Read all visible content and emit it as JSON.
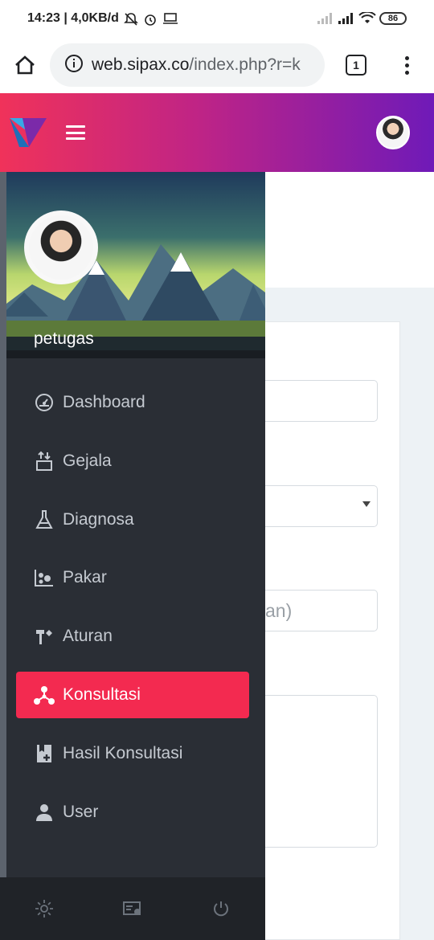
{
  "status_bar": {
    "time_speed": "14:23 | 4,0KB/d",
    "battery": "86",
    "icons": [
      "mute-bell-icon",
      "alarm-icon",
      "laptop-icon",
      "signal-icon",
      "signal-icon",
      "wifi-icon",
      "battery-icon"
    ]
  },
  "browser": {
    "url_domain": "web.sipax.co",
    "url_path": "/index.php?r=k",
    "tab_count": "1",
    "icons": [
      "home-icon",
      "info-icon",
      "more-vert-icon"
    ]
  },
  "header": {
    "icons": [
      "logo-icon",
      "menu-icon",
      "avatar"
    ]
  },
  "sidebar": {
    "profile_name": "petugas",
    "items": [
      {
        "label": "Dashboard",
        "icon": "dashboard-icon",
        "active": false
      },
      {
        "label": "Gejala",
        "icon": "sort-icon",
        "active": false
      },
      {
        "label": "Diagnosa",
        "icon": "flask-icon",
        "active": false
      },
      {
        "label": "Pakar",
        "icon": "chart-icon",
        "active": false
      },
      {
        "label": "Aturan",
        "icon": "tool-icon",
        "active": false
      },
      {
        "label": "Konsultasi",
        "icon": "hub-icon",
        "active": true
      },
      {
        "label": "Hasil Konsultasi",
        "icon": "bookmark-add-icon",
        "active": false
      },
      {
        "label": "User",
        "icon": "user-icon",
        "active": false
      }
    ],
    "footer_icons": [
      "settings-icon",
      "id-card-icon",
      "power-icon"
    ]
  },
  "content": {
    "partial_text": "an)"
  },
  "colors": {
    "header_start": "#f0325a",
    "header_end": "#6f1ab8",
    "sidebar_bg": "#2a2e35",
    "active_item": "#f32a50",
    "page_bg": "#edf2f5"
  }
}
